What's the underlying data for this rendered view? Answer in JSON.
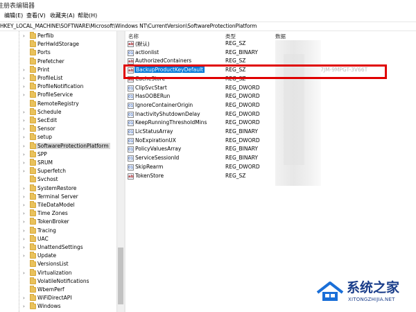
{
  "window": {
    "title": "注册表编辑器"
  },
  "menu": [
    {
      "label": "编辑(E)"
    },
    {
      "label": "查看(V)"
    },
    {
      "label": "收藏夹(A)"
    },
    {
      "label": "帮助(H)"
    }
  ],
  "address": {
    "path": "HKEY_LOCAL_MACHINE\\SOFTWARE\\Microsoft\\Windows NT\\CurrentVersion\\SoftwareProtectionPlatform"
  },
  "tree": {
    "items": [
      {
        "label": "Perflib",
        "expandable": true
      },
      {
        "label": "PerHwIdStorage",
        "expandable": false
      },
      {
        "label": "Ports",
        "expandable": false
      },
      {
        "label": "Prefetcher",
        "expandable": false
      },
      {
        "label": "Print",
        "expandable": true
      },
      {
        "label": "ProfileList",
        "expandable": true
      },
      {
        "label": "ProfileNotification",
        "expandable": true
      },
      {
        "label": "ProfileService",
        "expandable": true
      },
      {
        "label": "RemoteRegistry",
        "expandable": false
      },
      {
        "label": "Schedule",
        "expandable": true
      },
      {
        "label": "SecEdit",
        "expandable": true
      },
      {
        "label": "Sensor",
        "expandable": true
      },
      {
        "label": "setup",
        "expandable": true
      },
      {
        "label": "SoftwareProtectionPlatform",
        "expandable": true,
        "selected": true
      },
      {
        "label": "SPP",
        "expandable": true
      },
      {
        "label": "SRUM",
        "expandable": true
      },
      {
        "label": "Superfetch",
        "expandable": true
      },
      {
        "label": "Svchost",
        "expandable": false
      },
      {
        "label": "SystemRestore",
        "expandable": true
      },
      {
        "label": "Terminal Server",
        "expandable": true
      },
      {
        "label": "TileDataModel",
        "expandable": true
      },
      {
        "label": "Time Zones",
        "expandable": true
      },
      {
        "label": "TokenBroker",
        "expandable": true
      },
      {
        "label": "Tracing",
        "expandable": true
      },
      {
        "label": "UAC",
        "expandable": true
      },
      {
        "label": "UnattendSettings",
        "expandable": true
      },
      {
        "label": "Update",
        "expandable": true
      },
      {
        "label": "VersionsList",
        "expandable": false
      },
      {
        "label": "Virtualization",
        "expandable": true
      },
      {
        "label": "VolatileNotifications",
        "expandable": false
      },
      {
        "label": "WbemPerf",
        "expandable": false
      },
      {
        "label": "WiFiDirectAPI",
        "expandable": true
      },
      {
        "label": "Windows",
        "expandable": true
      }
    ]
  },
  "list": {
    "headers": {
      "name": "名称",
      "type": "类型",
      "data": "数据"
    },
    "rows": [
      {
        "name": "(默认)",
        "type": "REG_SZ",
        "icon": "ab",
        "data": ""
      },
      {
        "name": "actionlist",
        "type": "REG_BINARY",
        "icon": "bin",
        "data": ""
      },
      {
        "name": "AuthorizedContainers",
        "type": "REG_SZ",
        "icon": "ab",
        "data": ""
      },
      {
        "name": "BackupProductKeyDefault",
        "type": "REG_SZ",
        "icon": "ab",
        "data": "VK7JG-NPHTM-C97JM-9MPGT-3V66T",
        "highlight": true
      },
      {
        "name": "CacheStore",
        "type": "REG_SZ",
        "icon": "ab",
        "data": ""
      },
      {
        "name": "ClipSvcStart",
        "type": "REG_DWORD",
        "icon": "bin",
        "data": ""
      },
      {
        "name": "HasOOBERun",
        "type": "REG_DWORD",
        "icon": "bin",
        "data": ""
      },
      {
        "name": "IgnoreContainerOrigin",
        "type": "REG_DWORD",
        "icon": "bin",
        "data": ""
      },
      {
        "name": "InactivityShutdownDelay",
        "type": "REG_DWORD",
        "icon": "bin",
        "data": ""
      },
      {
        "name": "KeepRunningThresholdMins",
        "type": "REG_DWORD",
        "icon": "bin",
        "data": ""
      },
      {
        "name": "LicStatusArray",
        "type": "REG_BINARY",
        "icon": "bin",
        "data": ""
      },
      {
        "name": "NoExpirationUX",
        "type": "REG_DWORD",
        "icon": "bin",
        "data": ""
      },
      {
        "name": "PolicyValuesArray",
        "type": "REG_BINARY",
        "icon": "bin",
        "data": ""
      },
      {
        "name": "ServiceSessionId",
        "type": "REG_BINARY",
        "icon": "bin",
        "data": ""
      },
      {
        "name": "SkipRearm",
        "type": "REG_DWORD",
        "icon": "bin",
        "data": ""
      },
      {
        "name": "TokenStore",
        "type": "REG_SZ",
        "icon": "ab",
        "data": ""
      }
    ]
  },
  "watermark": {
    "text": "系统之家",
    "url": "XITONGZHIJIA.NET"
  },
  "colors": {
    "highlight_box": "#e00000",
    "selection": "#0078d7",
    "folder": "#e9c25c"
  }
}
